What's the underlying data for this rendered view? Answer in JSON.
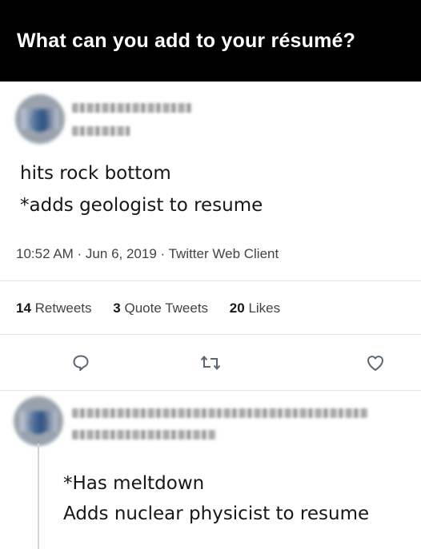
{
  "banner": {
    "title": "What can you add to your résumé?"
  },
  "tweet": {
    "lines": [
      "hits rock bottom",
      "*adds geologist to resume"
    ],
    "meta": "10:52 AM · Jun 6, 2019 · Twitter Web Client",
    "stats": {
      "retweets_count": "14",
      "retweets_label": "Retweets",
      "quotes_count": "3",
      "quotes_label": "Quote Tweets",
      "likes_count": "20",
      "likes_label": "Likes"
    },
    "actions": [
      "reply-icon",
      "retweet-icon",
      "like-icon"
    ]
  },
  "reply": {
    "lines": [
      "*Has meltdown",
      "Adds nuclear physicist to resume"
    ]
  },
  "colors": {
    "banner": "#000000",
    "icon": "#5b6670",
    "text": "#14171a",
    "meta": "#3f4448"
  }
}
